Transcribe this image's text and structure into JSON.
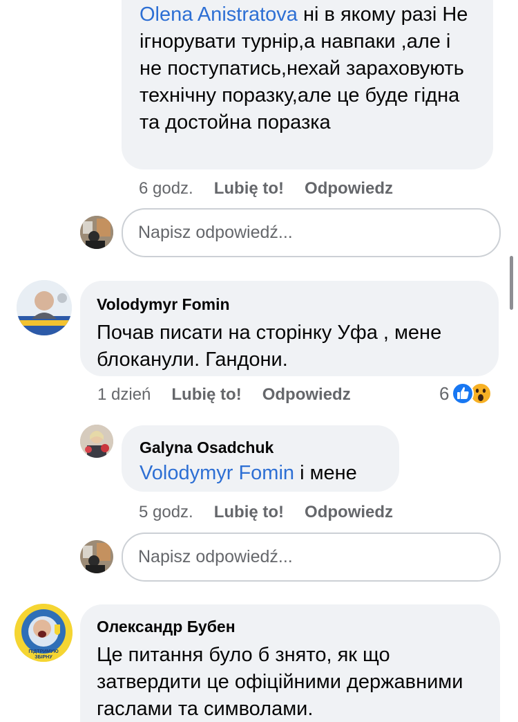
{
  "comments": [
    {
      "id": "olena-reply",
      "mention": "Olena Anistratova",
      "text": " ні в якому разі Не ігнорувати турнір,а навпаки ,але і не поступатись,нехай зараховують технічну поразку,але це буде гідна та достойна поразка",
      "time": "6 godz.",
      "like_label": "Lubię to!",
      "reply_label": "Odpowiedz"
    },
    {
      "id": "fomin",
      "author": "Volodymyr Fomin",
      "text": "Почав писати на сторінку Уфа , мене блоканули. Гандони.",
      "time": "1 dzień",
      "like_label": "Lubię to!",
      "reply_label": "Odpowiedz",
      "reaction_count": "6",
      "reaction_icons": [
        "like-icon",
        "wow-icon"
      ]
    },
    {
      "id": "galyna",
      "author": "Galyna  Osadchuk",
      "mention": "Volodymyr Fomin",
      "text": " і мене",
      "time": "5 godz.",
      "like_label": "Lubię to!",
      "reply_label": "Odpowiedz"
    },
    {
      "id": "buben",
      "author": "Олександр Бубен",
      "text": "Це питання було б знято, як що затвердити це офіційними державними гаслами та символами."
    }
  ],
  "reply_inputs": [
    {
      "placeholder": "Napisz odpowiedź..."
    },
    {
      "placeholder": "Napisz odpowiedź..."
    }
  ],
  "avatar_texts": {
    "buben": "ПІДТРИМУЮ ЗБІРНУ"
  },
  "colors": {
    "bubble": "#f0f2f5",
    "mention": "#2d6fd4",
    "meta": "#65676b",
    "like": "#1877f2",
    "wow": "#f7b125"
  }
}
